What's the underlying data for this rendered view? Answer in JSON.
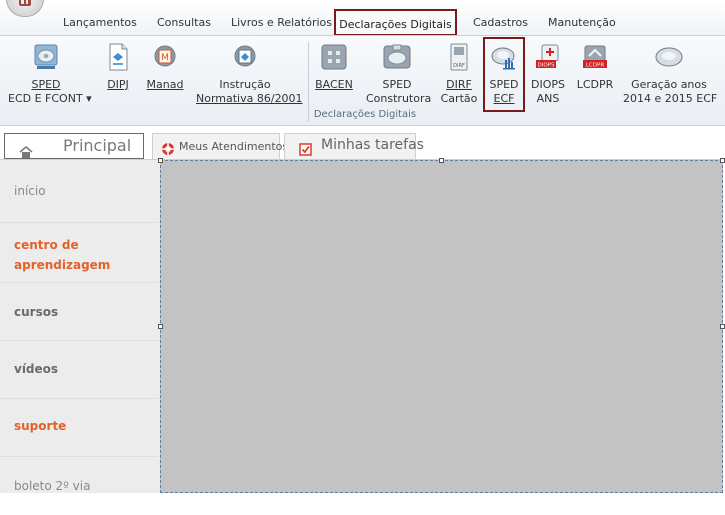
{
  "ribbon_tabs": [
    {
      "label": "Lançamentos"
    },
    {
      "label": "Consultas"
    },
    {
      "label": "Livros e Relatórios"
    },
    {
      "label": "Declarações Digitais",
      "active": true
    },
    {
      "label": "Cadastros"
    },
    {
      "label": "Manutenção"
    }
  ],
  "ribbon": {
    "buttons": {
      "sped_ecd": {
        "line1": "SPED",
        "line2": "ECD E FCONT ▾"
      },
      "dipj": {
        "line1": "DIPJ"
      },
      "manad": {
        "line1": "Manad"
      },
      "instrucao": {
        "line1": "Instrução",
        "line2": "Normativa 86/2001"
      },
      "bacen": {
        "line1": "BACEN"
      },
      "sped_construtora": {
        "line1": "SPED",
        "line2": "Construtora"
      },
      "dirf": {
        "line1": "DIRF",
        "line2": "Cartão"
      },
      "sped_ecf": {
        "line1": "SPED",
        "line2": "ECF"
      },
      "diops": {
        "line1": "DIOPS",
        "line2": "ANS"
      },
      "lcdpr": {
        "line1": "LCDPR"
      },
      "geracao": {
        "line1": "Geração anos",
        "line2": "2014 e 2015 ECF"
      }
    },
    "group_label": "Declarações Digitais",
    "icon_text": {
      "manad": "M",
      "dirf": "DIRF",
      "diops": "DIOPS",
      "lcdpr": "LCDPR"
    }
  },
  "subtabs": {
    "home": "Principal",
    "atendimentos": "Meus Atendimentos",
    "tarefas": "Minhas tarefas"
  },
  "sidenav": [
    {
      "label": "início"
    },
    {
      "label": "centro de aprendizagem"
    },
    {
      "label": "cursos"
    },
    {
      "label": "vídeos"
    },
    {
      "label": "suporte"
    },
    {
      "label": "boleto 2º via"
    }
  ],
  "colors": {
    "highlight": "#7a1a1a",
    "nav_orange": "#e2622a",
    "main_bg": "#c3c3c3"
  },
  "icons": {
    "home": "home-icon",
    "atendimentos": "lifebuoy-icon",
    "tarefas": "checkbox-icon"
  }
}
